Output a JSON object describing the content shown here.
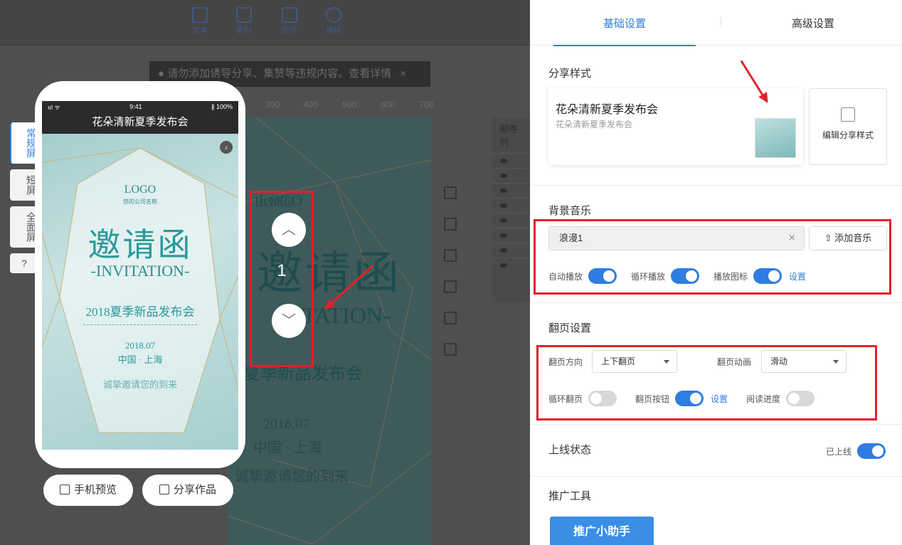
{
  "toolbar": {
    "items": [
      {
        "label": "文本",
        "icon": "text-icon"
      },
      {
        "label": "素材",
        "icon": "image-icon"
      },
      {
        "label": "控件",
        "icon": "widget-icon"
      },
      {
        "label": "趣味",
        "icon": "bulb-icon"
      }
    ]
  },
  "notice": {
    "text": "请勿添加诱导分享、集赞等违规内容。查看详情",
    "close": "×"
  },
  "ruler": [
    "300",
    "400",
    "500",
    "600",
    "700"
  ],
  "canvas": {
    "logo": "LOGO",
    "title": "邀请函",
    "subtitle": "VITATION-",
    "event": "夏季新品发布会",
    "date": "2018.07",
    "location": "中国 · 上海",
    "welcome": "诚挚邀请您的到来"
  },
  "layers": {
    "title": "部件列",
    "rows": [
      "开",
      "开",
      "开",
      "开",
      "开",
      "开",
      "开",
      "背"
    ]
  },
  "phone": {
    "status_signal": "ııl ᯤ",
    "status_time": "9:41",
    "status_battery": "∦ 100%",
    "title": "花朵清新夏季发布会",
    "logo": "LOGO",
    "company": "您的公司名称",
    "invite_title": "邀请函",
    "invite_sub": "-INVITATION-",
    "event": "2018夏季新品发布会",
    "date": "2018.07",
    "location": "中国 · 上海",
    "welcome": "诚挚邀请您的到来",
    "music_icon": "♪"
  },
  "screen_modes": [
    {
      "label": "常规屏",
      "active": true
    },
    {
      "label": "短屏",
      "active": false
    },
    {
      "label": "全面屏",
      "active": false
    },
    {
      "label": "?",
      "active": false
    }
  ],
  "bottom_buttons": {
    "preview": "手机预览",
    "share": "分享作品"
  },
  "page_nav": {
    "up": "︿",
    "page": "1",
    "down": "﹀"
  },
  "panel": {
    "tabs": [
      "基础设置",
      "高级设置"
    ],
    "share": {
      "section_title": "分享样式",
      "card_title": "花朵清新夏季发布会",
      "card_desc": "花朵清新夏季发布会",
      "edit_label": "编辑分享样式"
    },
    "music": {
      "section_title": "背景音乐",
      "track": "浪漫1",
      "clear": "×",
      "add_label": "添加音乐",
      "add_icon": "⇧",
      "autoplay_label": "自动播放",
      "autoplay_on": true,
      "loop_label": "循环播放",
      "loop_on": true,
      "icon_label": "播放图标",
      "icon_on": true,
      "settings_link": "设置"
    },
    "paging": {
      "section_title": "翻页设置",
      "direction_label": "翻页方向",
      "direction_value": "上下翻页",
      "animation_label": "翻页动画",
      "animation_value": "滑动",
      "loop_label": "循环翻页",
      "loop_on": false,
      "button_label": "翻页按钮",
      "button_on": true,
      "settings_link": "设置",
      "progress_label": "阅读进度",
      "progress_on": false
    },
    "online": {
      "section_title": "上线状态",
      "status_text": "已上线",
      "on": true
    },
    "promo": {
      "section_title": "推广工具",
      "button_label": "推广小助手"
    }
  },
  "colors": {
    "accent": "#2f7de1",
    "highlight": "#e3202b"
  }
}
